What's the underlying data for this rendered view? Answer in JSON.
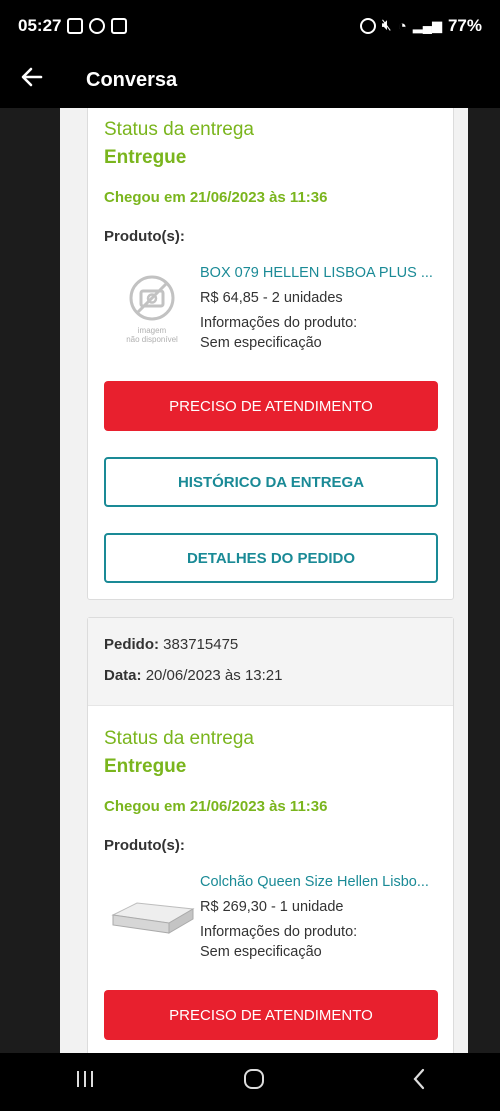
{
  "status_bar": {
    "time": "05:27",
    "battery": "77%"
  },
  "app_bar": {
    "title": "Conversa"
  },
  "card1": {
    "status_label": "Status da entrega",
    "status_value": "Entregue",
    "arrival": "Chegou em 21/06/2023 às 11:36",
    "products_label": "Produto(s):",
    "product": {
      "image_text_1": "imagem",
      "image_text_2": "não disponível",
      "name": "BOX 079 HELLEN LISBOA PLUS ...",
      "price": "R$ 64,85 - 2 unidades",
      "info_label": "Informações do produto:",
      "spec": "Sem especificação"
    },
    "btn_support": "PRECISO DE ATENDIMENTO",
    "btn_history": "HISTÓRICO DA ENTREGA",
    "btn_details": "DETALHES DO PEDIDO"
  },
  "card2": {
    "order_label": "Pedido:",
    "order_value": "383715475",
    "date_label": "Data:",
    "date_value": "20/06/2023 às 13:21",
    "status_label": "Status da entrega",
    "status_value": "Entregue",
    "arrival": "Chegou em 21/06/2023 às 11:36",
    "products_label": "Produto(s):",
    "product": {
      "name": "Colchão Queen Size Hellen Lisbo...",
      "price": "R$ 269,30 - 1 unidade",
      "info_label": "Informações do produto:",
      "spec": "Sem especificação"
    },
    "btn_support": "PRECISO DE ATENDIMENTO"
  }
}
